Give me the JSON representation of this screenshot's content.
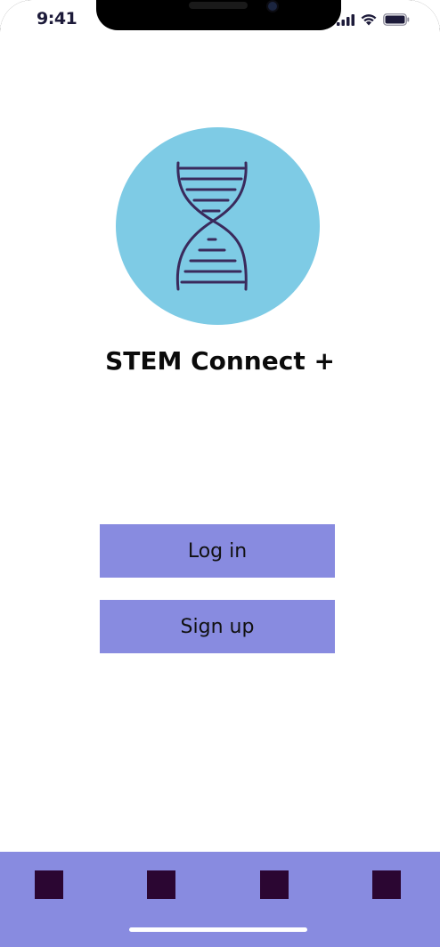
{
  "status_bar": {
    "time": "9:41",
    "icons": [
      "cellular-signal-icon",
      "wifi-icon",
      "battery-icon"
    ],
    "color": "#1d1b3a"
  },
  "logo": {
    "icon": "dna-helix-icon",
    "background": "#7ecbe5",
    "stroke": "#3a2a5c"
  },
  "app": {
    "title": "STEM Connect +"
  },
  "auth": {
    "login_label": "Log in",
    "signup_label": "Sign up",
    "button_color": "#888be0"
  },
  "tab_bar": {
    "background": "#888be0",
    "tab_color": "#2b0632",
    "tabs": [
      "tab-1-icon",
      "tab-2-icon",
      "tab-3-icon",
      "tab-4-icon"
    ]
  }
}
